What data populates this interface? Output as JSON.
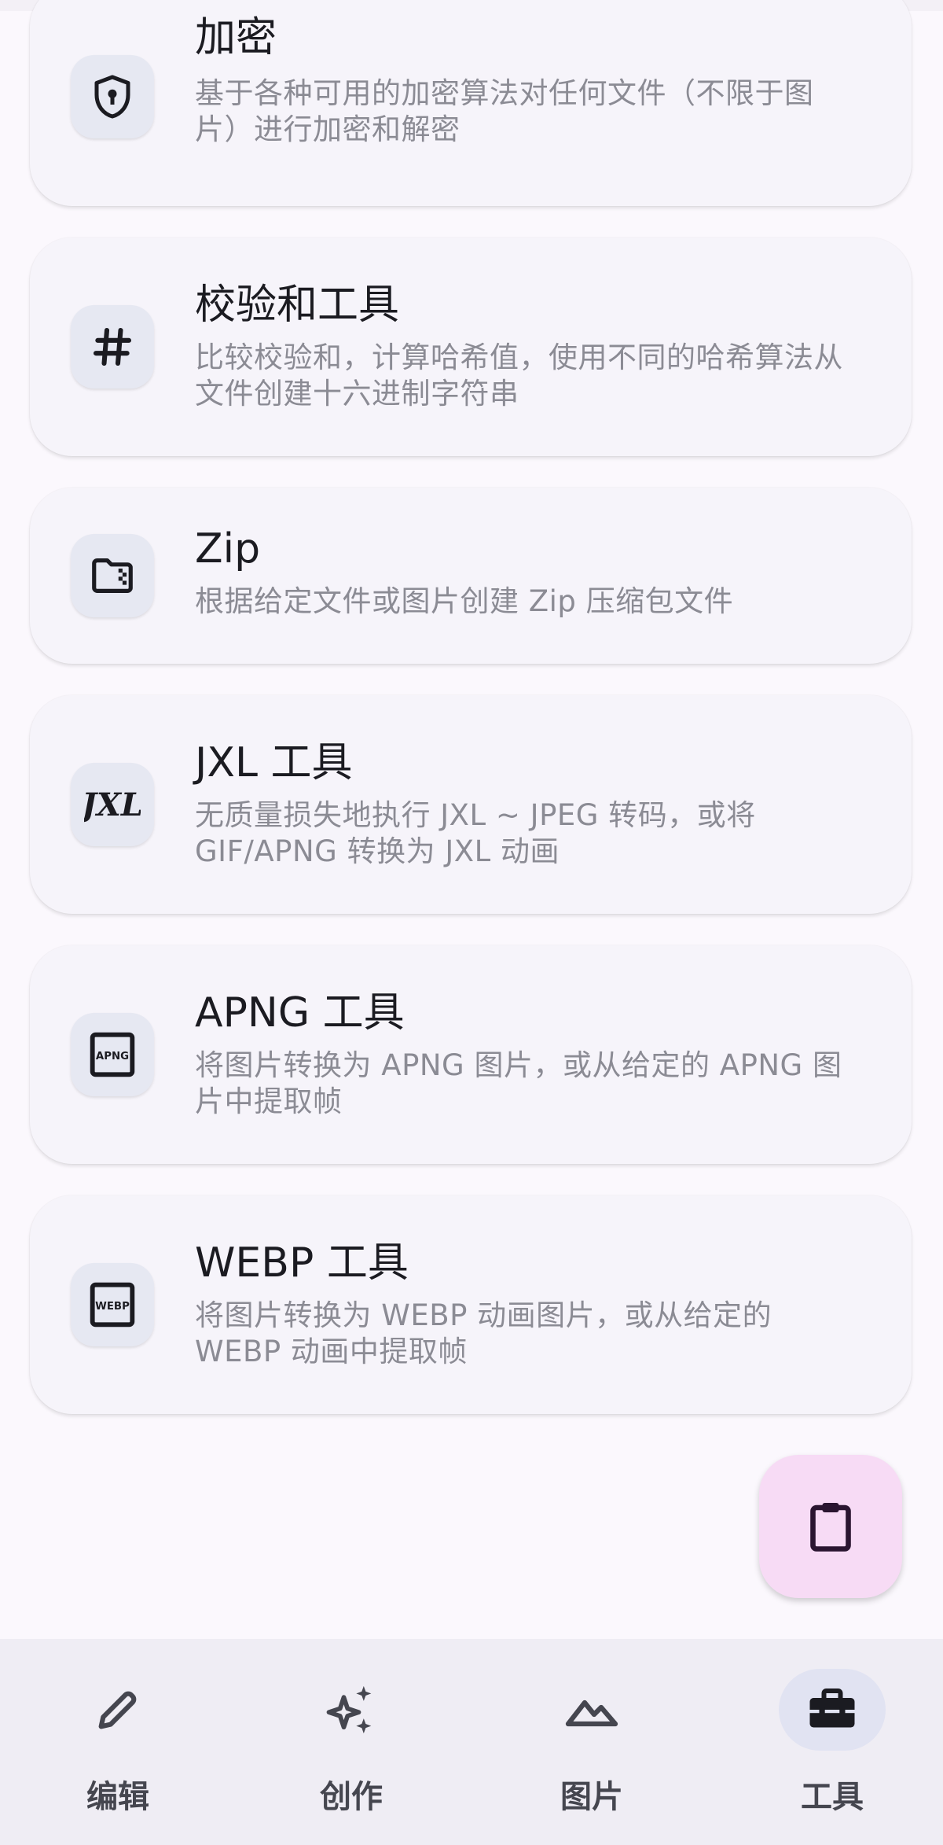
{
  "tools": [
    {
      "title": "加密",
      "description": "基于各种可用的加密算法对任何文件（不限于图片）进行加密和解密",
      "icon": "shield-lock-icon"
    },
    {
      "title": "校验和工具",
      "description": "比较校验和，计算哈希值，使用不同的哈希算法从文件创建十六进制字符串",
      "icon": "hash-icon"
    },
    {
      "title": "Zip",
      "description": "根据给定文件或图片创建 Zip 压缩包文件",
      "icon": "zip-folder-icon"
    },
    {
      "title": "JXL 工具",
      "description": "无质量损失地执行 JXL ~ JPEG 转码，或将 GIF/APNG 转换为 JXL 动画",
      "icon": "jxl-icon"
    },
    {
      "title": "APNG 工具",
      "description": "将图片转换为 APNG 图片，或从给定的 APNG 图片中提取帧",
      "icon": "apng-icon",
      "icon_text": "APNG"
    },
    {
      "title": "WEBP 工具",
      "description": "将图片转换为 WEBP 动画图片，或从给定的 WEBP 动画中提取帧",
      "icon": "webp-icon",
      "icon_text": "WEBP"
    }
  ],
  "fab": {
    "icon": "clipboard-icon"
  },
  "bottom_nav": {
    "items": [
      {
        "label": "编辑",
        "icon": "pencil-icon",
        "active": false
      },
      {
        "label": "创作",
        "icon": "sparkles-icon",
        "active": false
      },
      {
        "label": "图片",
        "icon": "mountains-icon",
        "active": false
      },
      {
        "label": "工具",
        "icon": "toolbox-icon",
        "active": true
      }
    ]
  },
  "colors": {
    "background": "#fbf8fd",
    "card": "#f6f4fa",
    "icon_container": "#e6e8f2",
    "fab": "#f7dbf5",
    "nav_active_pill": "#e1e3f2",
    "title_text": "#1b1b21",
    "desc_text": "#8b8b94"
  }
}
